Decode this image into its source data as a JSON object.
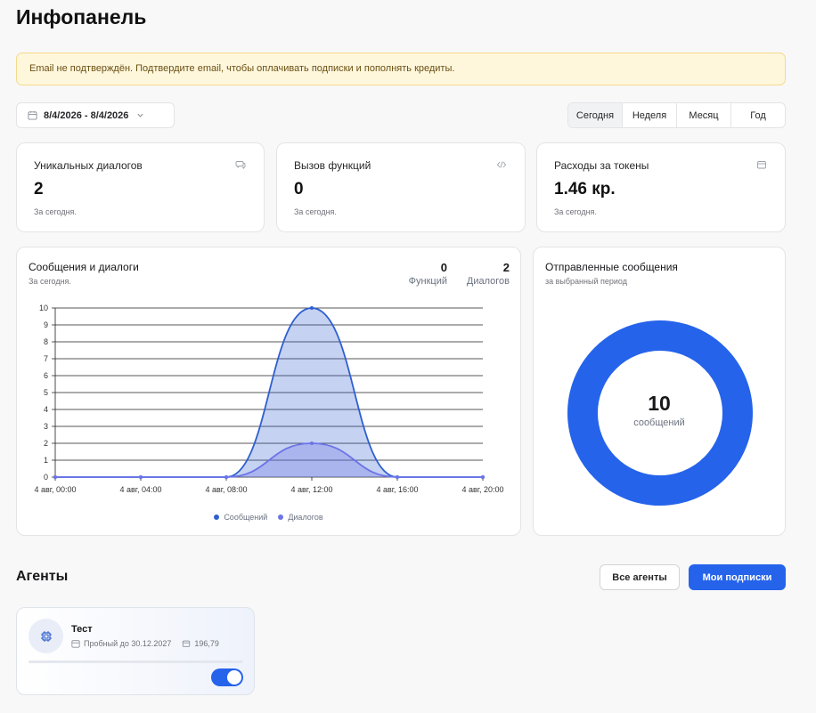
{
  "page": {
    "title": "Инфопанель"
  },
  "alert": {
    "text": "Email не подтверждён. Подтвердите email, чтобы оплачивать подписки и пополнять кредиты."
  },
  "filters": {
    "date_range": "8/4/2026 - 8/4/2026",
    "tabs": [
      "Сегодня",
      "Неделя",
      "Месяц",
      "Год"
    ],
    "active_tab": "Сегодня"
  },
  "stats": [
    {
      "label": "Уникальных диалогов",
      "value": "2",
      "sub": "За сегодня.",
      "icon": "chat-icon"
    },
    {
      "label": "Вызов функций",
      "value": "0",
      "sub": "За сегодня.",
      "icon": "code-icon"
    },
    {
      "label": "Расходы за токены",
      "value": "1.46 кр.",
      "sub": "За сегодня.",
      "icon": "wallet-icon"
    }
  ],
  "messages_chart": {
    "title": "Сообщения и диалоги",
    "subtitle": "За сегодня.",
    "kpis": [
      {
        "value": "0",
        "label": "Функций"
      },
      {
        "value": "2",
        "label": "Диалогов"
      }
    ]
  },
  "chart_data": [
    {
      "type": "area",
      "x": [
        "4 авг, 00:00",
        "4 авг, 04:00",
        "4 авг, 08:00",
        "4 авг, 12:00",
        "4 авг, 16:00",
        "4 авг, 20:00"
      ],
      "series": [
        {
          "name": "Сообщений",
          "values": [
            0,
            0,
            0,
            10,
            0,
            0
          ],
          "color": "#2f5fd0"
        },
        {
          "name": "Диалогов",
          "values": [
            0,
            0,
            0,
            2,
            0,
            0
          ],
          "color": "#6c74e6"
        }
      ],
      "ylim": [
        0,
        10
      ],
      "yticks": [
        "0",
        "1",
        "2",
        "3",
        "4",
        "5",
        "6",
        "7",
        "8",
        "9",
        "10"
      ],
      "grid": true,
      "legend": "bottom"
    },
    {
      "type": "pie",
      "title": "Отправленные сообщения",
      "subtitle": "за выбранный период",
      "values": [
        10
      ],
      "center_value": "10",
      "center_label": "сообщений",
      "color": "#2563eb"
    }
  ],
  "agents": {
    "title": "Агенты",
    "all_button": "Все агенты",
    "subs_button": "Мои подписки",
    "items": [
      {
        "name": "Тест",
        "trial": "Пробный до 30.12.2027",
        "credits": "196,79",
        "enabled": true,
        "progress": 0.0
      }
    ]
  }
}
